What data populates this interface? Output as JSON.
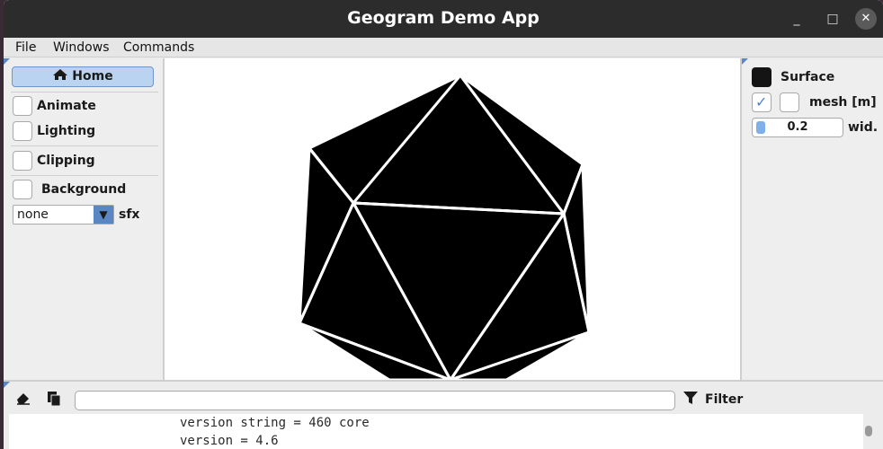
{
  "window": {
    "title": "Geogram Demo App"
  },
  "window_controls": {
    "minimize": "_",
    "maximize": "□",
    "close": "✕"
  },
  "menubar": {
    "items": [
      "File",
      "Windows",
      "Commands"
    ]
  },
  "left_panel": {
    "home_label": "Home",
    "animate_label": "Animate",
    "lighting_label": "Lighting",
    "clipping_label": "Clipping",
    "background_label": "Background",
    "sfx_select_value": "none",
    "sfx_label": "sfx"
  },
  "right_panel": {
    "surface_label": "Surface",
    "surface_color": "#141414",
    "mesh_label": "mesh [m]",
    "mesh_checked": true,
    "width_value": "0.2",
    "width_label": "wid."
  },
  "console": {
    "filter_label": "Filter",
    "filter_value": "",
    "lines": [
      "version string = 460 core",
      "version = 4.6"
    ]
  },
  "icons": {
    "home": "home-icon",
    "erase": "eraser-icon",
    "copy": "copy-icon",
    "filter": "filter-icon",
    "dropdown": "triangle-down-icon"
  },
  "colors": {
    "accent": "#5a86c4",
    "home_button_bg": "#b9d3f1",
    "titlebar": "#2c2c2c",
    "mesh_fill": "#000000",
    "mesh_edges": "#ffffff"
  }
}
